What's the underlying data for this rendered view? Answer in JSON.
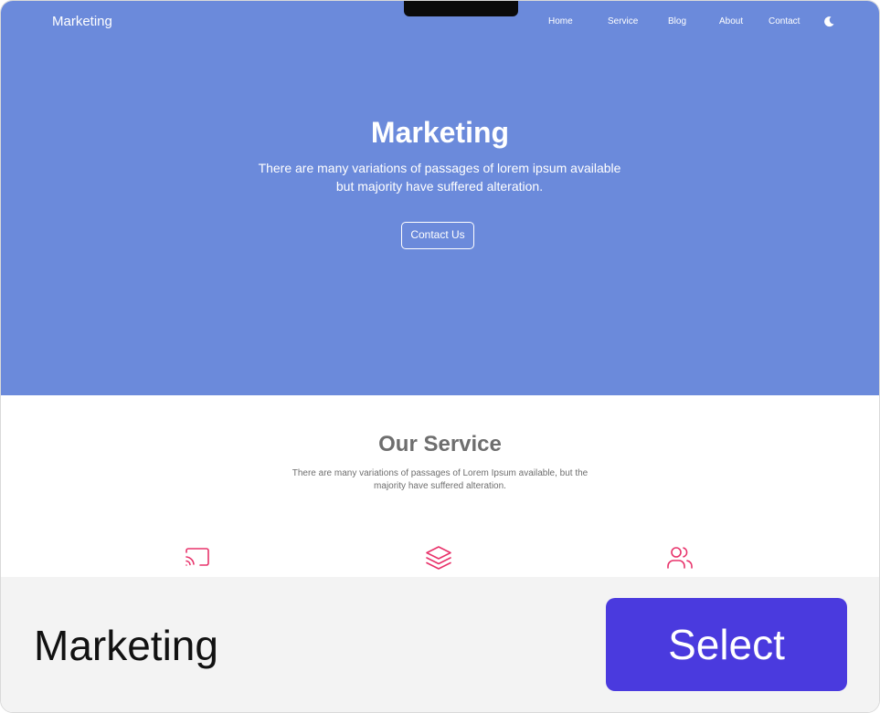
{
  "preview": {
    "nav": {
      "brand": "Marketing",
      "links": [
        "Home",
        "Service",
        "Blog",
        "About",
        "Contact"
      ],
      "theme_toggle_icon": "moon-icon"
    },
    "hero": {
      "title": "Marketing",
      "text_line1": "There are many variations of passages of lorem ipsum available",
      "text_line2": "but majority have suffered alteration.",
      "cta_label": "Contact Us",
      "background": "#6b8adb"
    },
    "service": {
      "title": "Our Service",
      "text_line1": "There are many variations of passages of Lorem Ipsum available, but the",
      "text_line2": "majority have suffered alteration.",
      "icons": [
        "cast-icon",
        "layers-icon",
        "users-icon"
      ],
      "icon_color": "#e8336b"
    }
  },
  "footer": {
    "template_name": "Marketing",
    "select_label": "Select",
    "button_color": "#4a3ade"
  }
}
